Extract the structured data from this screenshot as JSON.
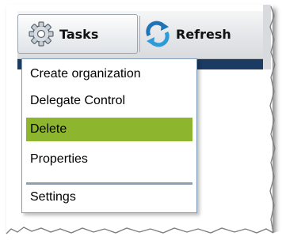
{
  "toolbar": {
    "tasks_label": "Tasks",
    "refresh_label": "Refresh",
    "tasks_icon": "gear-icon",
    "refresh_icon": "refresh-arrows-icon"
  },
  "menu": {
    "items": [
      {
        "label": "Create organization"
      },
      {
        "label": "Delegate Control"
      },
      {
        "label": "Delete",
        "highlighted": true
      },
      {
        "label": "Properties"
      },
      {
        "label": "Settings"
      }
    ]
  },
  "colors": {
    "highlight": "#8db52e",
    "menu_border": "#7f9db9",
    "strip": "#1c3b63",
    "separator": "#8a9fb4"
  }
}
